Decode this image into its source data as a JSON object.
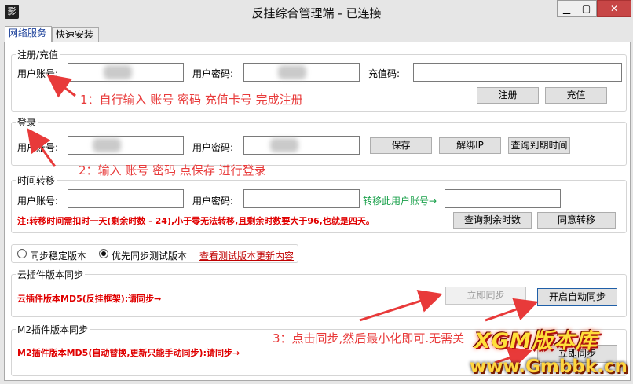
{
  "window": {
    "title": "反挂综合管理端 - 已连接",
    "app_icon": "影",
    "min_glyph": "▁",
    "max_glyph": "▢",
    "close_glyph": "✕"
  },
  "tabs": [
    {
      "label": "网络服务",
      "active": true
    },
    {
      "label": "快速安装",
      "active": false
    }
  ],
  "register": {
    "title": "注册/充值",
    "account_label": "用户账号:",
    "password_label": "用户密码:",
    "code_label": "充值码:",
    "account_value": "",
    "password_value": "",
    "code_value": "",
    "register_button": "注册",
    "recharge_button": "充值"
  },
  "login": {
    "title": "登录",
    "account_label": "用户账号:",
    "password_label": "用户密码:",
    "account_value": "",
    "password_value": "",
    "save_button": "保存",
    "unbind_button": "解绑IP",
    "expiry_button": "查询到期时间"
  },
  "transfer": {
    "title": "时间转移",
    "account_label": "用户账号:",
    "password_label": "用户密码:",
    "target_label": "转移此用户账号→",
    "account_value": "",
    "password_value": "",
    "target_value": "",
    "note": "注:转移时间需扣时一天(剩余时数 - 24),小于零无法转移,且剩余时数要大于96,也就是四天。",
    "query_button": "查询剩余时数",
    "agree_button": "同意转移"
  },
  "version": {
    "stable_label": "同步稳定版本",
    "test_label": "优先同步测试版本",
    "selected": "test",
    "changelog_link": "查看测试版本更新内容"
  },
  "cloud_sync": {
    "title": "云插件版本同步",
    "status": "云插件版本MD5(反挂框架):请同步→",
    "sync_button": "立即同步",
    "auto_sync_button": "开启自动同步"
  },
  "m2_sync": {
    "title": "M2插件版本同步",
    "status": "M2插件版本MD5(自动替换,更新只能手动同步):请同步→",
    "sync_button": "立即同步"
  },
  "annotations": {
    "step1": "1：自行输入 账号 密码  充值卡号 完成注册",
    "step2": "2：输入 账号 密码 点保存 进行登录",
    "step3": "3：点击同步,然后最小化即可.无需关"
  },
  "watermark": {
    "logo": "XGM版本库",
    "url": "www.Gmbbk.cn"
  },
  "colors": {
    "annotation": "#e83a3a",
    "warning": "#e00000",
    "link": "#c00000",
    "accent_green": "#19a04a",
    "close_button": "#c74646"
  }
}
